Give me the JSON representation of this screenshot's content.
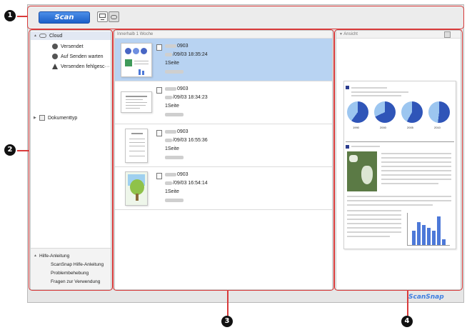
{
  "callouts": [
    "1",
    "2",
    "3",
    "4"
  ],
  "toolbar": {
    "scan_label": "Scan",
    "computer_icon": "computer-icon",
    "cloud_icon": "cloud-icon"
  },
  "sidebar": {
    "cloud_label": "Cloud",
    "items": [
      {
        "label": "Versendet",
        "icon": "check-circle-icon"
      },
      {
        "label": "Auf Senden warten",
        "icon": "pause-circle-icon"
      },
      {
        "label": "Versenden fehlgesc···",
        "icon": "warning-icon"
      }
    ],
    "doctype_label": "Dokumenttyp",
    "help_title": "Hilfe-Anleitung",
    "help_items": [
      "ScanSnap Hilfe-Anleitung",
      "Problembehebung",
      "Fragen zur Verwendung"
    ]
  },
  "list": {
    "header": "Innerhalb 1 Woche",
    "entries": [
      {
        "name": "0903",
        "date": "/09/03 18:35:24",
        "pages": "1Seite",
        "selected": true
      },
      {
        "name": "0903",
        "date": "/09/03 18:34:23",
        "pages": "1Seite",
        "selected": false
      },
      {
        "name": "0903",
        "date": "/09/03 16:55:36",
        "pages": "1Seite",
        "selected": false
      },
      {
        "name": "0903",
        "date": "/09/03 16:54:14",
        "pages": "1Seite",
        "selected": false
      }
    ]
  },
  "preview": {
    "header": "Ansicht",
    "years": [
      "1990",
      "2000",
      "2005",
      "2010"
    ],
    "pie_values": [
      0.6,
      0.68,
      0.58,
      0.52
    ],
    "bar_values": [
      5,
      8,
      7,
      6,
      5,
      10,
      2
    ]
  },
  "brand": "ScanSnap",
  "colors": {
    "accent": "#1c5fc9",
    "callout_border": "#d93a3a",
    "selection": "#b8d3f2"
  }
}
